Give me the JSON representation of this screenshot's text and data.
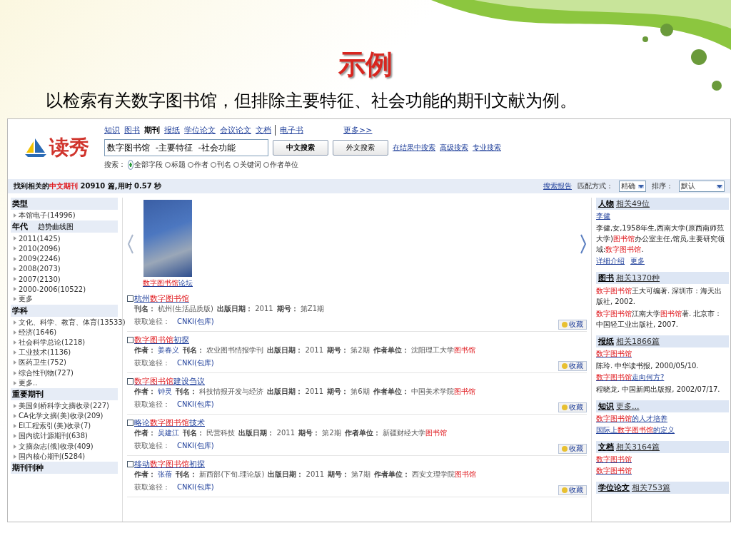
{
  "slide": {
    "title": "示例",
    "subtitle": "以检索有关数字图书馆，但排除主要特征、社会功能的期刊文献为例。"
  },
  "page": {
    "logo": "读秀",
    "nav": [
      {
        "label": "知识",
        "selected": false
      },
      {
        "label": "图书",
        "selected": false
      },
      {
        "label": "期刊",
        "selected": true
      },
      {
        "label": "报纸",
        "selected": false
      },
      {
        "label": "学位论文",
        "selected": false
      },
      {
        "label": "会议论文",
        "selected": false
      },
      {
        "label": "文档",
        "selected": false
      },
      {
        "label": "电子书",
        "selected": false
      }
    ],
    "nav_more": "更多>>",
    "search": {
      "value": "数字图书馆  -主要特征  -社会功能"
    },
    "buttons": [
      {
        "label": "中文搜索",
        "primary": true
      },
      {
        "label": "外文搜索",
        "primary": false
      }
    ],
    "links": [
      "在结果中搜索",
      "高级搜索",
      "专业搜索"
    ],
    "scope_label": "搜索：",
    "scopes": [
      {
        "label": "全部字段",
        "selected": true
      },
      {
        "label": "标题",
        "selected": false
      },
      {
        "label": "作者",
        "selected": false
      },
      {
        "label": "刊名",
        "selected": false
      },
      {
        "label": "关键词",
        "selected": false
      },
      {
        "label": "作者单位",
        "selected": false
      }
    ],
    "summary": [
      {
        "text": "找到相关的",
        "highlight": false
      },
      {
        "text": "中文期刊",
        "highlight": true
      },
      {
        "text": " 20910 篇,用时 0.57 秒",
        "highlight": false
      }
    ],
    "report_link": "搜索报告",
    "match_label": "匹配方式：",
    "match_value": "精确",
    "sort_label": "排序：",
    "sort_value": "默认",
    "sidebar": [
      {
        "title": "类型",
        "items": [
          "本馆电子(14996)"
        ]
      },
      {
        "title": "年代",
        "extra": "趋势曲线图",
        "items": [
          "2011(1425)",
          "2010(2096)",
          "2009(2246)",
          "2008(2073)",
          "2007(2130)",
          "2000-2006(10522)",
          "更多"
        ]
      },
      {
        "title": "学科",
        "items": [
          "文化、科学、教育、体育(13533)",
          "经济(1646)",
          "社会科学总论(1218)",
          "工业技术(1136)",
          "医药卫生(752)",
          "综合性刊物(727)",
          "更多.."
        ]
      },
      {
        "title": "重要期刊",
        "items": [
          "美国剑桥科学文摘收录(227)",
          "CA化学文摘(美)收录(209)",
          "EI工程索引(美)收录(7)",
          "国内统计源期刊(638)",
          "文摘杂志(俄)收录(409)",
          "国内核心期刊(5284)"
        ]
      },
      {
        "title": "期刊刊种"
      }
    ],
    "cover_caption": [
      {
        "text": "数字图书馆",
        "highlight": true
      },
      {
        "text": "论坛",
        "highlight": false
      }
    ],
    "results": [
      {
        "checked": false,
        "title": [
          {
            "text": "杭州",
            "highlight": false
          },
          {
            "text": "数字图书馆",
            "highlight": true
          }
        ],
        "meta": [
          {
            "label": "刊名：",
            "kind": "plain",
            "value": [
              {
                "text": "杭州(生活品质版)",
                "highlight": false
              }
            ]
          },
          {
            "label": "出版日期：",
            "kind": "plain",
            "value": [
              {
                "text": "2011",
                "highlight": false
              }
            ]
          },
          {
            "label": "期号：",
            "kind": "plain",
            "value": [
              {
                "text": "第Z1期",
                "highlight": false
              }
            ]
          }
        ],
        "source_label": "获取途径：",
        "source": "CNKI(包库)",
        "save": "收藏"
      },
      {
        "checked": false,
        "title": [
          {
            "text": "数字图书馆",
            "highlight": true
          },
          {
            "text": "初探",
            "highlight": false
          }
        ],
        "meta": [
          {
            "label": "作者：",
            "kind": "link",
            "value": [
              {
                "text": "姜春义",
                "highlight": false
              }
            ]
          },
          {
            "label": "刊名：",
            "kind": "plain",
            "value": [
              {
                "text": "农业图书情报学刊",
                "highlight": false
              }
            ]
          },
          {
            "label": "出版日期：",
            "kind": "plain",
            "value": [
              {
                "text": "2011",
                "highlight": false
              }
            ]
          },
          {
            "label": "期号：",
            "kind": "plain",
            "value": [
              {
                "text": "第2期",
                "highlight": false
              }
            ]
          },
          {
            "label": "作者单位：",
            "kind": "plain",
            "value": [
              {
                "text": "沈阳理工大学",
                "highlight": false
              },
              {
                "text": "图书馆",
                "highlight": true
              }
            ]
          }
        ],
        "source_label": "获取途径：",
        "source": "CNKI(包库)",
        "save": "收藏"
      },
      {
        "checked": false,
        "title": [
          {
            "text": "数字图书馆",
            "highlight": true
          },
          {
            "text": "建设刍议",
            "highlight": false
          }
        ],
        "meta": [
          {
            "label": "作者：",
            "kind": "link",
            "value": [
              {
                "text": "钟灵",
                "highlight": false
              }
            ]
          },
          {
            "label": "刊名：",
            "kind": "plain",
            "value": [
              {
                "text": "科技情报开发与经济",
                "highlight": false
              }
            ]
          },
          {
            "label": "出版日期：",
            "kind": "plain",
            "value": [
              {
                "text": "2011",
                "highlight": false
              }
            ]
          },
          {
            "label": "期号：",
            "kind": "plain",
            "value": [
              {
                "text": "第6期",
                "highlight": false
              }
            ]
          },
          {
            "label": "作者单位：",
            "kind": "plain",
            "value": [
              {
                "text": "中国美术学院",
                "highlight": false
              },
              {
                "text": "图书馆",
                "highlight": true
              }
            ]
          }
        ],
        "source_label": "获取途径：",
        "source": "CNKI(包库)",
        "save": "收藏"
      },
      {
        "checked": false,
        "title": [
          {
            "text": "略论",
            "highlight": false
          },
          {
            "text": "数字图书馆",
            "highlight": true
          },
          {
            "text": "技术",
            "highlight": false
          }
        ],
        "meta": [
          {
            "label": "作者：",
            "kind": "link",
            "value": [
              {
                "text": "吴建江",
                "highlight": false
              }
            ]
          },
          {
            "label": "刊名：",
            "kind": "plain",
            "value": [
              {
                "text": "民营科技",
                "highlight": false
              }
            ]
          },
          {
            "label": "出版日期：",
            "kind": "plain",
            "value": [
              {
                "text": "2011",
                "highlight": false
              }
            ]
          },
          {
            "label": "期号：",
            "kind": "plain",
            "value": [
              {
                "text": "第2期",
                "highlight": false
              }
            ]
          },
          {
            "label": "作者单位：",
            "kind": "plain",
            "value": [
              {
                "text": "新疆财经大学",
                "highlight": false
              },
              {
                "text": "图书馆",
                "highlight": true
              }
            ]
          }
        ],
        "source_label": "获取途径：",
        "source": "CNKI(包库)",
        "save": "收藏"
      },
      {
        "checked": false,
        "title": [
          {
            "text": "移动",
            "highlight": false
          },
          {
            "text": "数字图书馆",
            "highlight": true
          },
          {
            "text": "初探",
            "highlight": false
          }
        ],
        "meta": [
          {
            "label": "作者：",
            "kind": "link",
            "value": [
              {
                "text": "张蓓",
                "highlight": false
              }
            ]
          },
          {
            "label": "刊名：",
            "kind": "plain",
            "value": [
              {
                "text": "新西部(下旬.理论版)",
                "highlight": false
              }
            ]
          },
          {
            "label": "出版日期：",
            "kind": "plain",
            "value": [
              {
                "text": "2011",
                "highlight": false
              }
            ]
          },
          {
            "label": "期号：",
            "kind": "plain",
            "value": [
              {
                "text": "第7期",
                "highlight": false
              }
            ]
          },
          {
            "label": "作者单位：",
            "kind": "plain",
            "value": [
              {
                "text": "西安文理学院",
                "highlight": false
              },
              {
                "text": "图书馆",
                "highlight": true
              }
            ]
          }
        ],
        "source_label": "获取途径：",
        "source": "CNKI(包库)",
        "save": "收藏"
      }
    ],
    "panels": [
      {
        "title": "人物",
        "count": "相关49位",
        "entries": [
          {
            "kind": "link",
            "text": [
              {
                "text": "李健",
                "highlight": false
              }
            ]
          },
          {
            "kind": "text",
            "text": [
              {
                "text": " 李健,女,1958年生,西南大学(原西南师范大学)",
                "highlight": false
              },
              {
                "text": "图书馆",
                "highlight": true
              },
              {
                "text": "办公室主任,馆员,主要研究领域:",
                "highlight": false
              },
              {
                "text": "数字图书馆",
                "highlight": true
              },
              {
                "text": ".",
                "highlight": false
              }
            ]
          },
          {
            "kind": "actions",
            "items": [
              "详细介绍",
              "更多"
            ]
          }
        ]
      },
      {
        "title": "图书",
        "count": "相关1370种",
        "entries": [
          {
            "kind": "text",
            "text": [
              {
                "text": "数字图书馆",
                "highlight": true
              },
              {
                "text": "王大可编著. 深圳市：海天出版社, 2002.",
                "highlight": false
              }
            ]
          },
          {
            "kind": "text",
            "text": [
              {
                "text": "数字图书馆",
                "highlight": true
              },
              {
                "text": "江南大学",
                "highlight": false
              },
              {
                "text": "图书馆",
                "highlight": true
              },
              {
                "text": "著. 北京市：中国轻工业出版社, 2007.",
                "highlight": false
              }
            ]
          }
        ]
      },
      {
        "title": "报纸",
        "count": "相关1866篇",
        "entries": [
          {
            "kind": "link",
            "text": [
              {
                "text": "数字图书馆",
                "highlight": true
              }
            ]
          },
          {
            "kind": "text",
            "text": [
              {
                "text": "陈玲. 中华读书报, 2000/05/10.",
                "highlight": false
              }
            ]
          },
          {
            "kind": "link",
            "text": [
              {
                "text": "数字图书馆",
                "highlight": true
              },
              {
                "text": "走向何方?",
                "highlight": false
              }
            ]
          },
          {
            "kind": "text",
            "text": [
              {
                "text": "程晓龙. 中国新闻出版报, 2002/07/17.",
                "highlight": false
              }
            ]
          }
        ]
      },
      {
        "title": "知识",
        "count": "更多...",
        "entries": [
          {
            "kind": "link",
            "text": [
              {
                "text": "数字图书馆",
                "highlight": true
              },
              {
                "text": "的人才培养",
                "highlight": false
              }
            ]
          },
          {
            "kind": "link",
            "text": [
              {
                "text": "国际上",
                "highlight": false
              },
              {
                "text": "数字图书馆",
                "highlight": true
              },
              {
                "text": "的定义",
                "highlight": false
              }
            ]
          }
        ]
      },
      {
        "title": "文档",
        "count": "相关3164篇",
        "entries": [
          {
            "kind": "link",
            "text": [
              {
                "text": "数字图书馆",
                "highlight": true
              }
            ]
          },
          {
            "kind": "link",
            "text": [
              {
                "text": "数字图书馆",
                "highlight": true
              }
            ]
          }
        ]
      },
      {
        "title": "学位论文",
        "count": "相关753篇"
      }
    ]
  }
}
